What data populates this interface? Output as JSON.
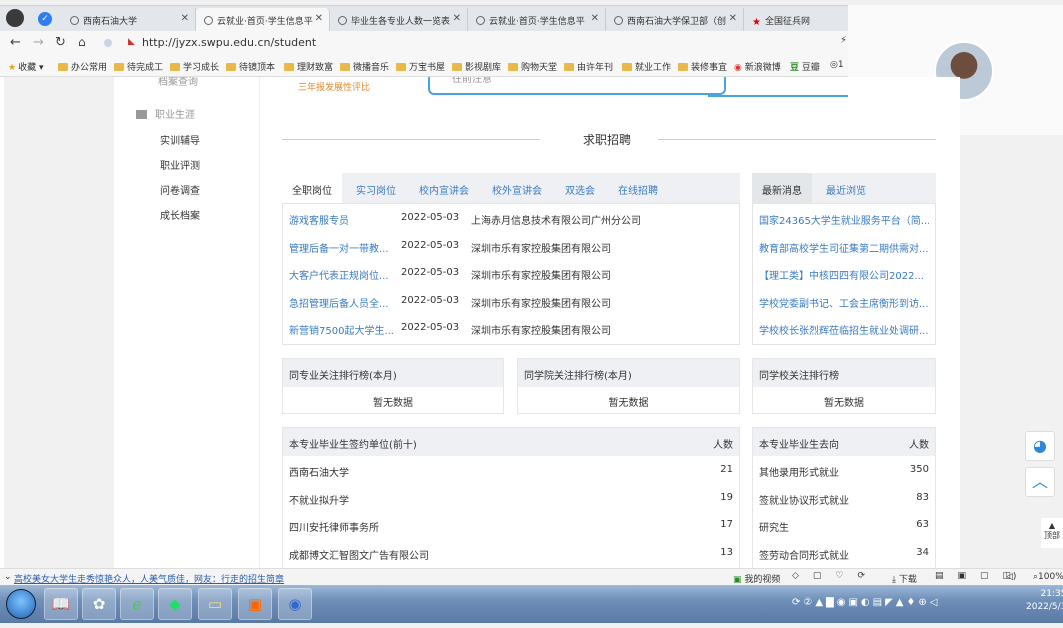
{
  "tabs": [
    {
      "label": "西南石油大学",
      "active": false
    },
    {
      "label": "云就业·首页·学生信息平",
      "active": true
    },
    {
      "label": "毕业生各专业人数一览表",
      "active": false
    },
    {
      "label": "云就业·首页·学生信息平",
      "active": false
    },
    {
      "label": "西南石油大学保卫部（创",
      "active": false
    },
    {
      "label": "全国征兵网",
      "active": false
    }
  ],
  "address": {
    "url": "http://jyzx.swpu.edu.cn/student"
  },
  "bookmarks": [
    "收藏",
    "办公常用",
    "待完成工",
    "学习成长",
    "待镜顶本",
    "理财致富",
    "微播音乐",
    "万宝书屋",
    "影视剧库",
    "购物天堂",
    "由许年刊",
    "就业工作",
    "装修事宜",
    "新浪微博",
    "豆瓣",
    "1"
  ],
  "sidebar": {
    "top_partial": "档案查询",
    "section": "职业生涯",
    "items": [
      "实训辅导",
      "职业评测",
      "问卷调查",
      "成长档案"
    ]
  },
  "top_card": {
    "orange_text": "三年报发展性评比",
    "card_text": "往前注意"
  },
  "section_title": "求职招聘",
  "job_tabs": [
    "全职岗位",
    "实习岗位",
    "校内宣讲会",
    "校外宣讲会",
    "双选会",
    "在线招聘"
  ],
  "jobs": [
    {
      "title": "游戏客服专员",
      "date": "2022-05-03",
      "company": "上海赤月信息技术有限公司广州分公司"
    },
    {
      "title": "管理后备一对一带教...",
      "date": "2022-05-03",
      "company": "深圳市乐有家控股集团有限公司"
    },
    {
      "title": "大客户代表正规岗位...",
      "date": "2022-05-03",
      "company": "深圳市乐有家控股集团有限公司"
    },
    {
      "title": "急招管理后备人员全...",
      "date": "2022-05-03",
      "company": "深圳市乐有家控股集团有限公司"
    },
    {
      "title": "新营销7500起大学生...",
      "date": "2022-05-03",
      "company": "深圳市乐有家控股集团有限公司"
    }
  ],
  "news_tabs": [
    "最新消息",
    "最近浏览"
  ],
  "news": [
    "国家24365大学生就业服务平台（简...",
    "教育部高校学生司征集第二期供需对...",
    "【理工类】中核四四有限公司2022...",
    "学校党委副书记、工会主席衡形到访...",
    "学校校长张烈辉莅临招生就业处调研..."
  ],
  "rankings": [
    {
      "title": "同专业关注排行榜(本月)",
      "body": "暂无数据"
    },
    {
      "title": "同学院关注排行榜(本月)",
      "body": "暂无数据"
    },
    {
      "title": "同学校关注排行榜",
      "body": "暂无数据"
    }
  ],
  "sign_table": {
    "title": "本专业毕业生签约单位(前十)",
    "count_label": "人数",
    "rows": [
      {
        "name": "西南石油大学",
        "count": "21"
      },
      {
        "name": "不就业拟升学",
        "count": "19"
      },
      {
        "name": "四川安托律师事务所",
        "count": "17"
      },
      {
        "name": "成都博文汇智图文广告有限公司",
        "count": "13"
      }
    ]
  },
  "dest_table": {
    "title": "本专业毕业生去向",
    "count_label": "人数",
    "rows": [
      {
        "name": "其他录用形式就业",
        "count": "350"
      },
      {
        "name": "签就业协议形式就业",
        "count": "83"
      },
      {
        "name": "研究生",
        "count": "63"
      },
      {
        "name": "签劳动合同形式就业",
        "count": "34"
      }
    ]
  },
  "float_buttons": {
    "totop_label": "顶部"
  },
  "status_bar": {
    "news": "高校美女大学生走秀惊艳众人，人美气质佳，网友：行走的招生简章",
    "video": "我的视频",
    "download": "下载",
    "zoom": "100%"
  },
  "clock": {
    "time": "21:35",
    "date": "2022/5/3"
  }
}
